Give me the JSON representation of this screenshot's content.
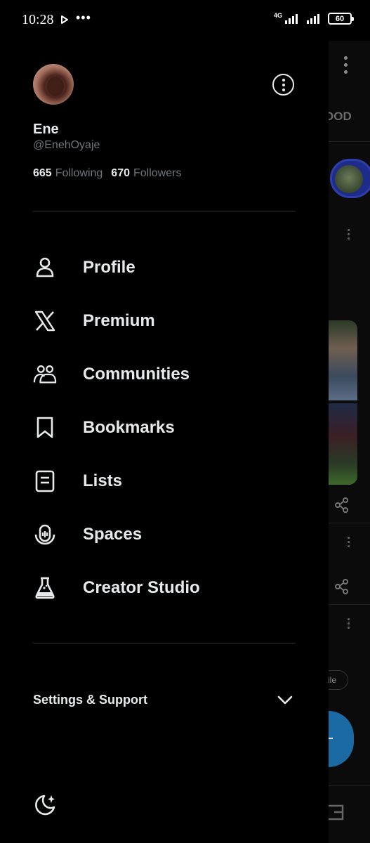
{
  "status_bar": {
    "time": "10:28",
    "dots": "•••",
    "network": "4G",
    "battery": "60"
  },
  "drawer": {
    "display_name": "Ene",
    "handle": "@EnehOyaje",
    "following_count": "665",
    "following_label": "Following",
    "followers_count": "670",
    "followers_label": "Followers",
    "menu": [
      {
        "label": "Profile",
        "icon": "person-icon"
      },
      {
        "label": "Premium",
        "icon": "x-logo-icon"
      },
      {
        "label": "Communities",
        "icon": "communities-icon"
      },
      {
        "label": "Bookmarks",
        "icon": "bookmark-icon"
      },
      {
        "label": "Lists",
        "icon": "list-icon"
      },
      {
        "label": "Spaces",
        "icon": "spaces-icon"
      },
      {
        "label": "Creator Studio",
        "icon": "flask-icon"
      }
    ],
    "settings_label": "Settings & Support"
  },
  "background_feed": {
    "tab_fragment": "OOD",
    "pill_fragment": "ile"
  },
  "colors": {
    "background": "#000000",
    "text_primary": "#e7e9ea",
    "text_secondary": "#71767b",
    "divider": "#2f3336"
  }
}
